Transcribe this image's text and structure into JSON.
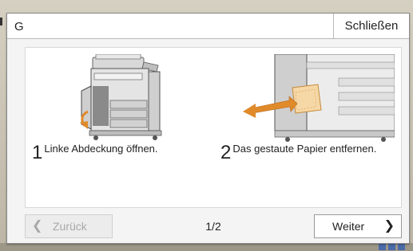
{
  "dialog": {
    "title": "G",
    "close_label": "Schließen"
  },
  "steps": [
    {
      "number": "1",
      "text": "Linke Abdeckung öffnen.",
      "illustration": "printer-open-left-cover-icon"
    },
    {
      "number": "2",
      "text": "Das gestaute Papier entfernen.",
      "illustration": "remove-jammed-paper-icon"
    }
  ],
  "navigation": {
    "back_label": "Zurück",
    "next_label": "Weiter",
    "page_indicator": "1/2",
    "back_enabled": false
  },
  "colors": {
    "accent_arrow": "#e08a2a",
    "disabled_text": "#a8a8a8"
  }
}
